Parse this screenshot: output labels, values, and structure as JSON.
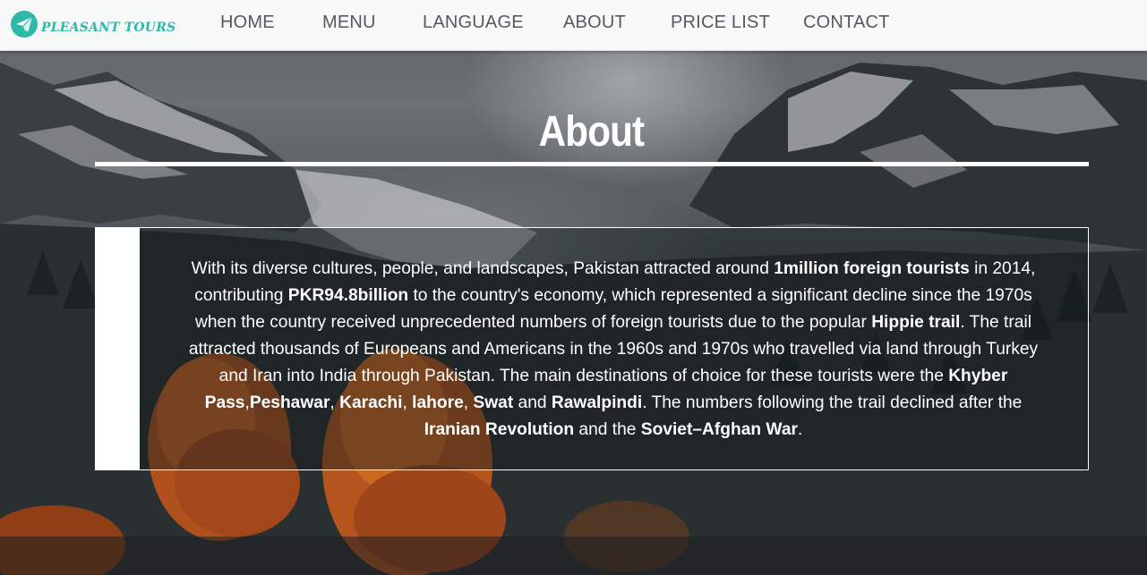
{
  "brand": {
    "name": "PLEASANT TOURS",
    "icon": "paper-plane-icon",
    "color": "#2fb8a8"
  },
  "nav": {
    "items": [
      "HOME",
      "MENU",
      "LANGUAGE",
      "ABOUT",
      "PRICE LIST",
      "CONTACT"
    ]
  },
  "about": {
    "title": "About",
    "segments": [
      "With its diverse cultures, people, and landscapes, Pakistan attracted around ",
      "1million foreign tourists",
      " in 2014, contributing ",
      "PKR94.8billion",
      " to the country's economy, which represented a significant decline since the 1970s when the country received unprecedented numbers of foreign tourists due to the popular ",
      "Hippie trail",
      ". The trail attracted thousands of Europeans and Americans in the 1960s and 1970s who travelled via land through Turkey and Iran into India through Pakistan. The main destinations of choice for these tourists were the ",
      "Khyber Pass",
      ",",
      "Peshawar",
      ", ",
      "Karachi",
      ", ",
      "lahore",
      ", ",
      "Swat",
      " and ",
      "Rawalpindi",
      ". The numbers following the trail declined after the ",
      "Iranian Revolution",
      " and the ",
      "Soviet–Afghan War",
      "."
    ]
  }
}
